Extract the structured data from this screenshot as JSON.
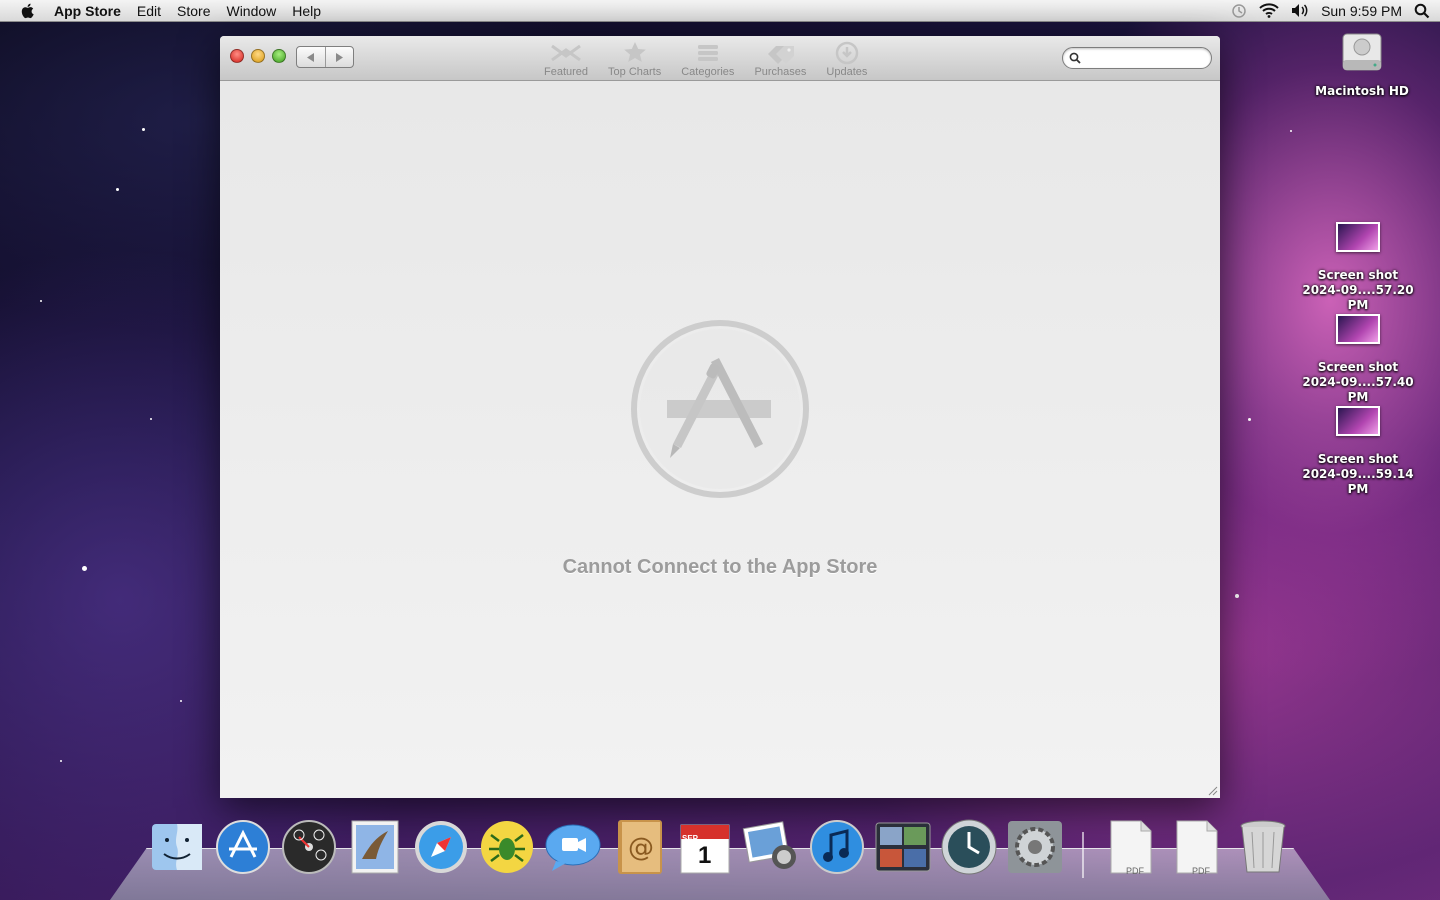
{
  "menubar": {
    "app_name": "App Store",
    "menus": [
      "Edit",
      "Store",
      "Window",
      "Help"
    ],
    "clock": "Sun 9:59 PM"
  },
  "window": {
    "tabs": [
      {
        "label": "Featured",
        "icon": "featured-icon"
      },
      {
        "label": "Top Charts",
        "icon": "star-icon"
      },
      {
        "label": "Categories",
        "icon": "categories-icon"
      },
      {
        "label": "Purchases",
        "icon": "tag-icon"
      },
      {
        "label": "Updates",
        "icon": "download-icon"
      }
    ],
    "search_placeholder": "",
    "error_message": "Cannot Connect to the App Store"
  },
  "desktop": {
    "drive_label": "Macintosh HD",
    "screenshots": [
      {
        "line1": "Screen shot",
        "line2": "2024-09....57.20 PM"
      },
      {
        "line1": "Screen shot",
        "line2": "2024-09....57.40 PM"
      },
      {
        "line1": "Screen shot",
        "line2": "2024-09....59.14 PM"
      }
    ]
  },
  "dock": {
    "apps": [
      "Finder",
      "App Store",
      "Dashboard",
      "Mail",
      "Safari",
      "Spider",
      "iChat",
      "Address Book",
      "iCal",
      "iPhoto",
      "iTunes",
      "Spaces",
      "Time Machine",
      "System Preferences"
    ],
    "calendar_month": "SEP",
    "calendar_day": "1",
    "doc_label": "PDF"
  },
  "colors": {
    "error_text": "#9c9c9c",
    "close": "#e0443b",
    "minimize": "#e9a82a",
    "maximize": "#5fbf3a"
  }
}
